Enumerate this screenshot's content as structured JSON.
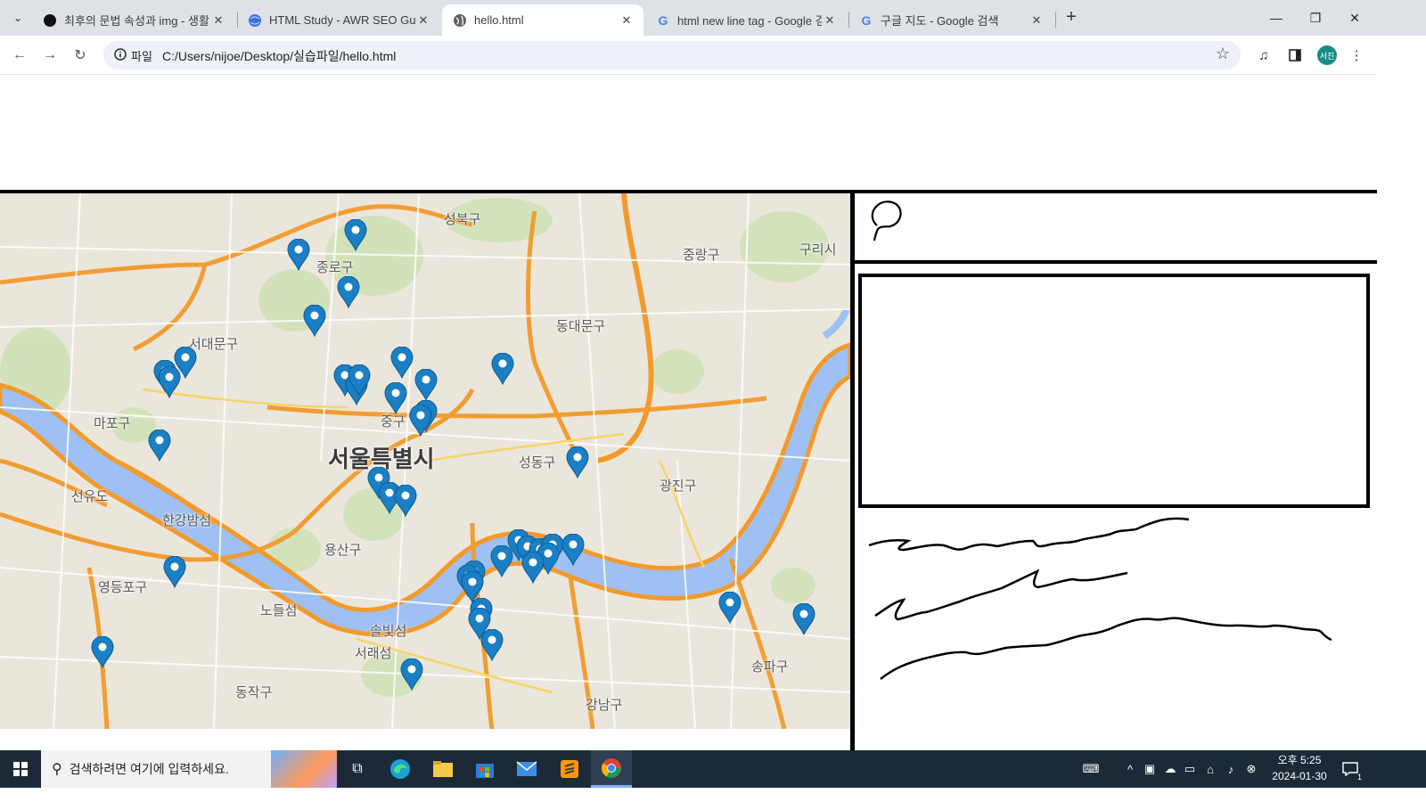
{
  "browser": {
    "tabs": [
      {
        "title": "최후의 문법 속성과 img - 생활",
        "favicon": "black-circle-icon",
        "active": false
      },
      {
        "title": "HTML Study - AWR SEO Guide",
        "favicon": "globe-blue-icon",
        "active": false
      },
      {
        "title": "hello.html",
        "favicon": "globe-gray-icon",
        "active": true
      },
      {
        "title": "html new line tag - Google 검",
        "favicon": "google-g-icon",
        "active": false
      },
      {
        "title": "구글 지도 - Google 검색",
        "favicon": "google-g-icon",
        "active": false
      }
    ],
    "address": {
      "chip_label": "파일",
      "url": "C:/Users/nijoe/Desktop/실습파일/hello.html"
    },
    "avatar_text": "서진"
  },
  "map": {
    "labels": [
      {
        "text": "성북구",
        "style": "normal"
      },
      {
        "text": "종로구",
        "style": "normal"
      },
      {
        "text": "중랑구",
        "style": "normal"
      },
      {
        "text": "구리시",
        "style": "normal"
      },
      {
        "text": "서대문구",
        "style": "normal"
      },
      {
        "text": "동대문구",
        "style": "normal"
      },
      {
        "text": "마포구",
        "style": "normal"
      },
      {
        "text": "중구",
        "style": "normal"
      },
      {
        "text": "서울특별시",
        "style": "big"
      },
      {
        "text": "성동구",
        "style": "normal"
      },
      {
        "text": "광진구",
        "style": "normal"
      },
      {
        "text": "선유도",
        "style": "normal"
      },
      {
        "text": "한강밤섬",
        "style": "normal"
      },
      {
        "text": "용산구",
        "style": "normal"
      },
      {
        "text": "영등포구",
        "style": "normal"
      },
      {
        "text": "노들섬",
        "style": "normal"
      },
      {
        "text": "솔빛섬",
        "style": "normal"
      },
      {
        "text": "서래섬",
        "style": "normal"
      },
      {
        "text": "송파구",
        "style": "normal"
      },
      {
        "text": "동작구",
        "style": "normal"
      },
      {
        "text": "강남구",
        "style": "normal"
      }
    ],
    "marker_icon": "map-pin-icon",
    "marker_color": "#1a7fc4"
  },
  "taskbar": {
    "search_placeholder": "검색하려면 여기에 입력하세요.",
    "clock_time": "오후 5:25",
    "clock_date": "2024-01-30",
    "notification_count": "1"
  }
}
